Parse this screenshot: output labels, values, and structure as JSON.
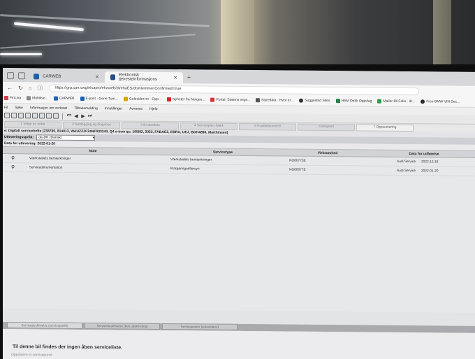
{
  "browser": {
    "tabs": [
      {
        "label": "CARWEB",
        "active": false
      },
      {
        "label": "Elektronisk tjenesteinformasjons",
        "active": true
      }
    ],
    "url": "https://grp.cpn.vwg/elsapro/ehaweb/dt/ehaES/dtsKlemmenConfirmed=true",
    "bookmarks": [
      {
        "label": "FinLiva",
        "color": "#c44"
      },
      {
        "label": "Mobilise...",
        "color": "#888"
      },
      {
        "label": "CARWEB",
        "color": "#2a64b0"
      },
      {
        "label": "E-post · Gene Tum...",
        "color": "#1a5fb4"
      },
      {
        "label": "Gulesider.no · Opp...",
        "color": "#d6a200"
      },
      {
        "label": "Nyheter fra Norges...",
        "color": "#d22"
      },
      {
        "label": "Portal: Statens vegv...",
        "color": "#d33"
      },
      {
        "label": "Styredata · Hvor er...",
        "color": "#555"
      },
      {
        "label": "Suggested Sites",
        "color": "#333"
      },
      {
        "label": "HAM Dekk Oppslag",
        "color": "#2a7d4a"
      },
      {
        "label": "Mailer Bil Folio · iK...",
        "color": "#2a9d4a"
      },
      {
        "label": "Free BMW VIN Dec...",
        "color": "#2a2a2a"
      }
    ]
  },
  "app": {
    "menu": [
      "Fil",
      "Søke",
      "Informasjon om verkstøi",
      "Tilbakemelding",
      "Innstillinger",
      "Avvanse",
      "Hjelp"
    ],
    "steps": [
      "1 Velge en ordre",
      "2 Nettlegging og diagnose",
      "3 Brukerdata",
      "4 Serviceplan Sjekk",
      "5 Kvalitetskontroll",
      "6 Bilsjekkt",
      "7 Oppsumering"
    ],
    "vehicle_info": "e: Digitalt servicehefte (238785, 814813, WAUZZZF24NF033340, Q4 e-tron qu. 185/82, 2022, FABAE2, EBRA, UEJ, BDH4896, Marthinsen)",
    "lang_label": "Utleveringsspråk:",
    "lang_value": "da-DK (Dansk)",
    "date_label": "Dato for utlevering: 2022-01-20",
    "table": {
      "headers": [
        "Note",
        "Servicetype",
        "Virksomhed",
        "Dato for udførelse"
      ],
      "rows": [
        {
          "note": "Værkstedets bemærkninger",
          "type": "Værkstedets bemærkninger",
          "company": "NO00773E",
          "service": "Audi Service",
          "date": "2022-12-18"
        },
        {
          "note": "Servicedokumentation",
          "type": "Klargøringseftersyn",
          "company": "NO00077E",
          "service": "Audi Service",
          "date": "2022-01-20"
        }
      ]
    },
    "bottom_tabs": [
      "Servicebeskrivelse (servicepunkt)",
      "Servicebeskrivelse (kun udskrivning)",
      "Serviceposter (sekundære)"
    ],
    "no_list_msg": "Til denne bil findes der ingen åben serviceliste.",
    "no_list_sub": "Oppdatere et servicepunkt"
  }
}
